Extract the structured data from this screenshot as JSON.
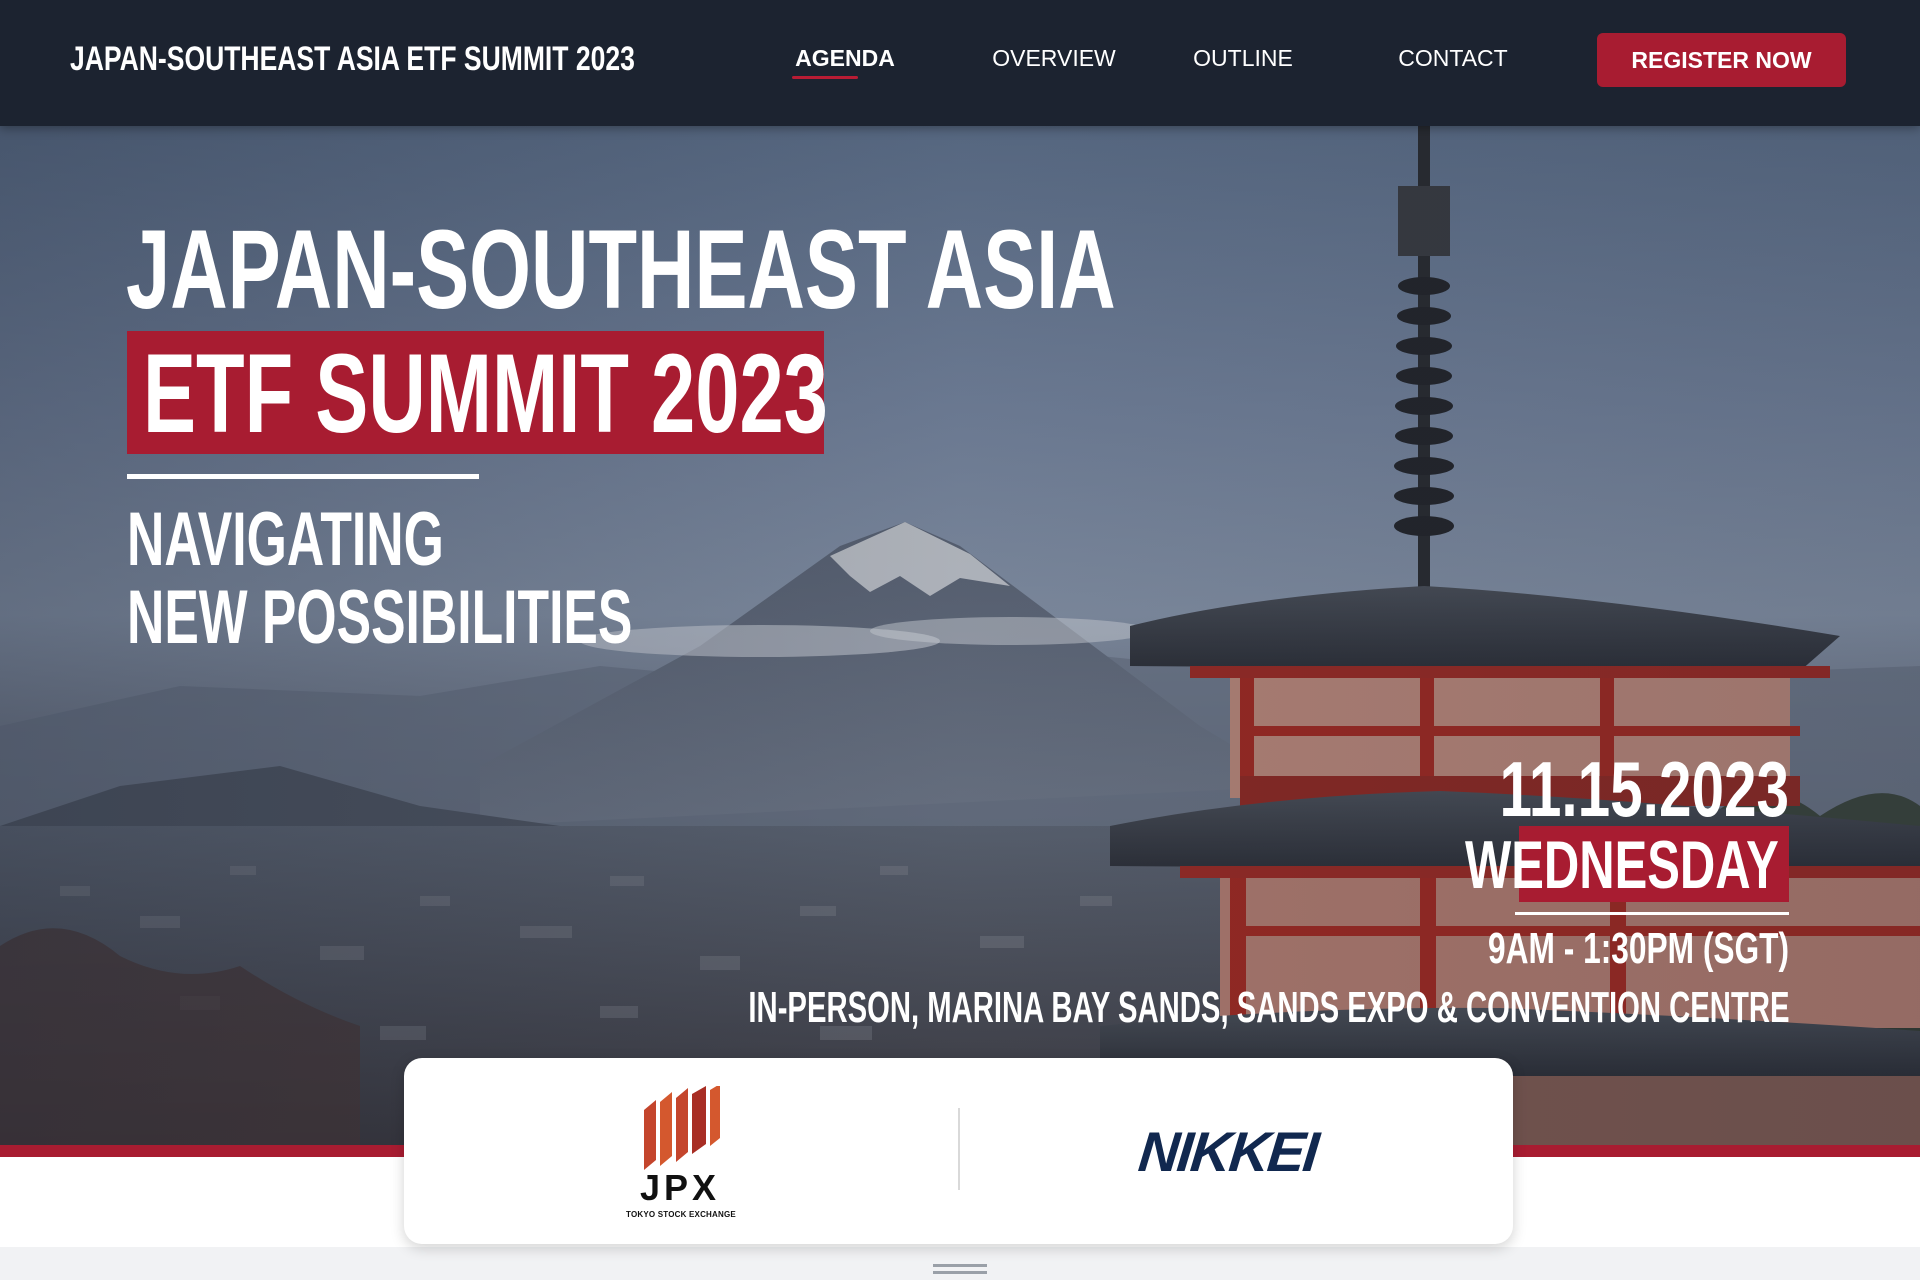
{
  "header": {
    "site_title": "JAPAN-SOUTHEAST ASIA ETF SUMMIT 2023",
    "nav": [
      {
        "label": "AGENDA",
        "active": true
      },
      {
        "label": "OVERVIEW",
        "active": false
      },
      {
        "label": "OUTLINE",
        "active": false
      },
      {
        "label": "CONTACT",
        "active": false
      }
    ],
    "cta_label": "REGISTER NOW"
  },
  "hero": {
    "title_line1": "JAPAN-SOUTHEAST ASIA",
    "title_line2": "ETF SUMMIT 2023",
    "tagline_line1": "NAVIGATING",
    "tagline_line2": "NEW POSSIBILITIES",
    "date": "11.15.2023",
    "day": "WEDNESDAY",
    "time": "9AM - 1:30PM (SGT)",
    "venue": "IN-PERSON, MARINA BAY SANDS, SANDS EXPO & CONVENTION CENTRE"
  },
  "partners": {
    "jpx": {
      "wordmark": "JPX",
      "subtitle": "TOKYO STOCK EXCHANGE"
    },
    "nikkei": {
      "wordmark": "NIKKEI"
    }
  },
  "colors": {
    "header_bg": "#1c2330",
    "accent_red": "#a81c31",
    "nikkei_navy": "#11284f"
  }
}
